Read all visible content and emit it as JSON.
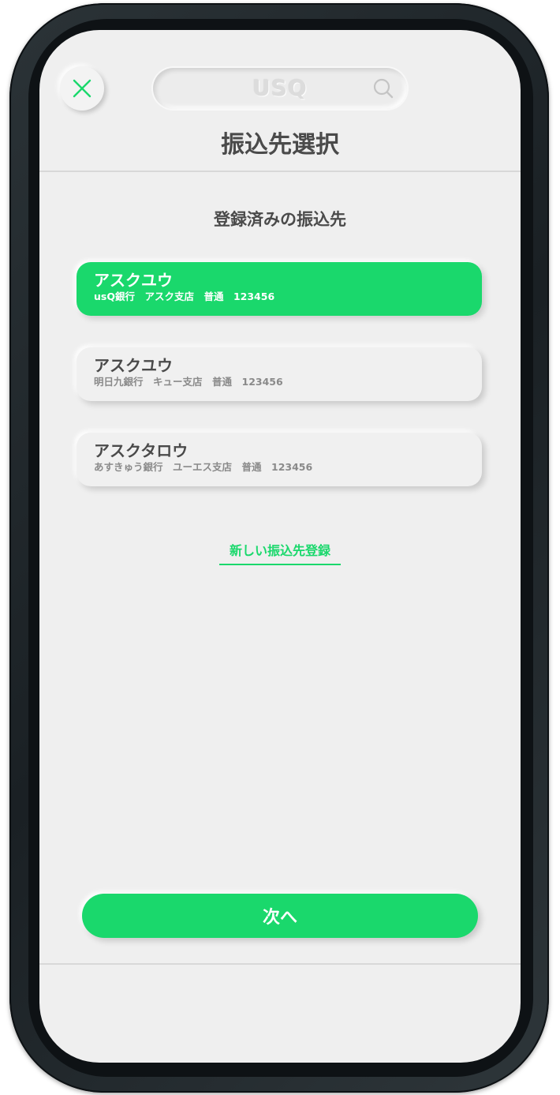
{
  "header": {
    "logo_text": "USQ",
    "title": "振込先選択"
  },
  "section": {
    "title": "登録済みの振込先"
  },
  "payees": [
    {
      "name": "アスクユウ",
      "detail": "usQ銀行　アスク支店　普通　123456",
      "selected": true
    },
    {
      "name": "アスクユウ",
      "detail": "明日九銀行　キュー支店　普通　123456",
      "selected": false
    },
    {
      "name": "アスクタロウ",
      "detail": "あすきゅう銀行　ユーエス支店　普通　123456",
      "selected": false
    }
  ],
  "actions": {
    "new_payee_label": "新しい振込先登録",
    "next_label": "次へ"
  },
  "colors": {
    "accent": "#1ad86c",
    "background": "#efefef",
    "text": "#4a4a4a",
    "subtext": "#8a8a8a"
  },
  "icons": {
    "close": "close-icon",
    "search": "search-icon"
  }
}
